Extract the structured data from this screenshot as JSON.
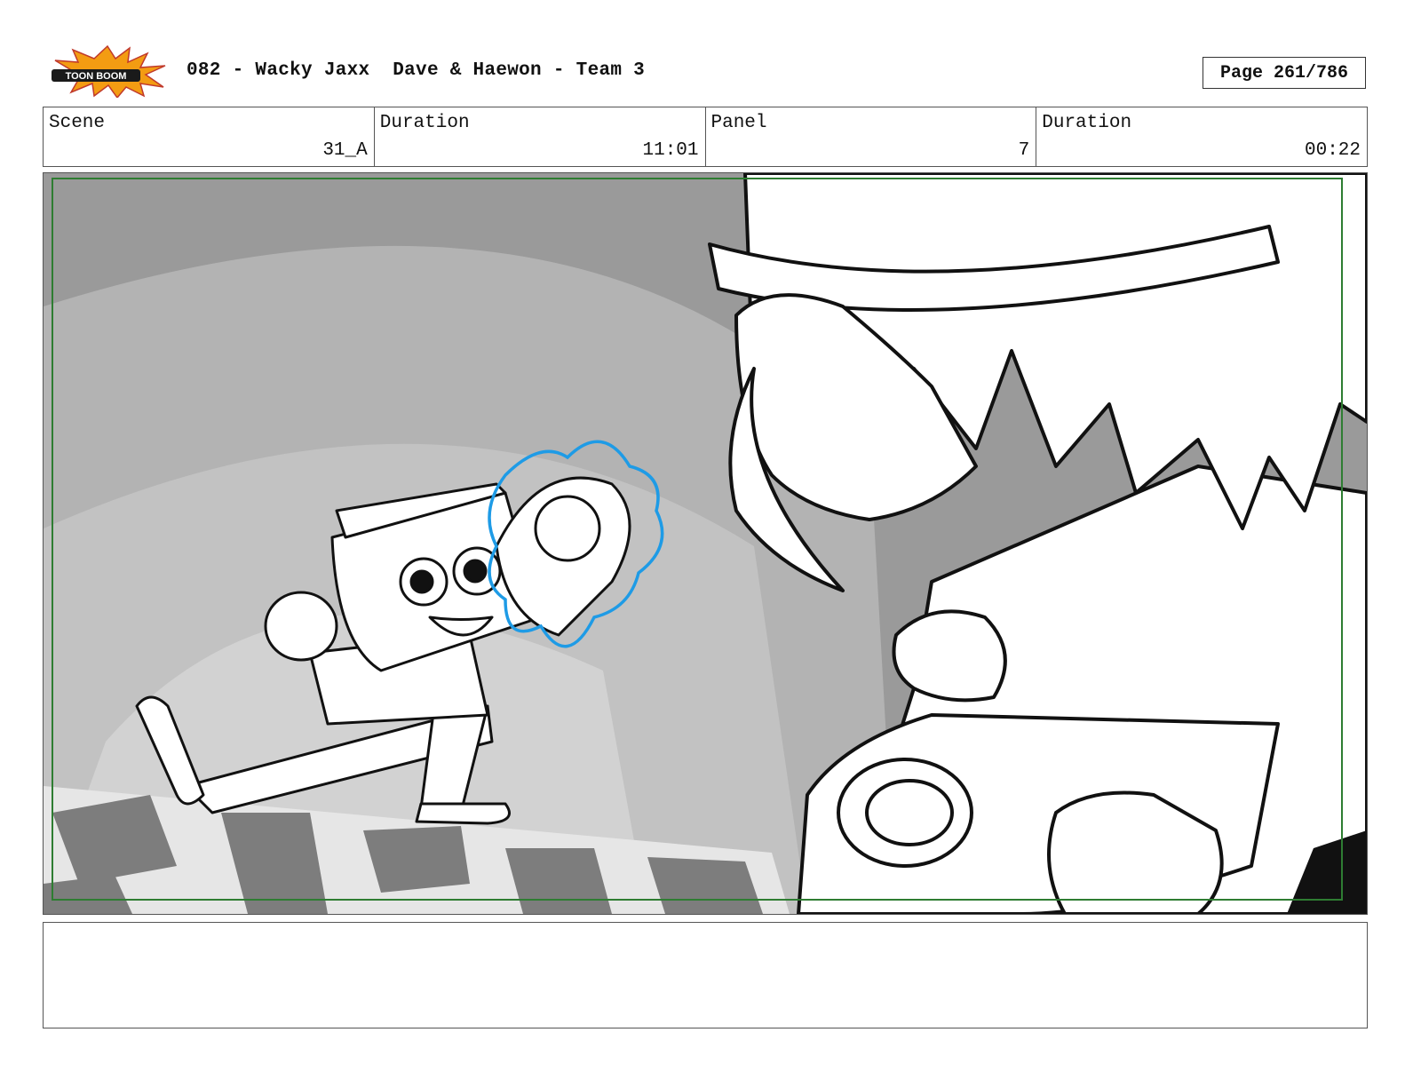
{
  "header": {
    "logo_text": "TOON BOOM",
    "title": "082 - Wacky Jaxx  Dave & Haewon - Team 3",
    "page": "Page 261/786"
  },
  "info": {
    "scene_label": "Scene",
    "scene_value": "31_A",
    "duration_label": "Duration",
    "duration_value": "11:01",
    "panel_label": "Panel",
    "panel_value": "7",
    "panel_duration_label": "Duration",
    "panel_duration_value": "00:22"
  },
  "notes": {
    "text": ""
  },
  "colors": {
    "safe_frame": "#2e7d32",
    "glow_outline": "#1e9be6",
    "logo_burst": "#f39c12"
  }
}
